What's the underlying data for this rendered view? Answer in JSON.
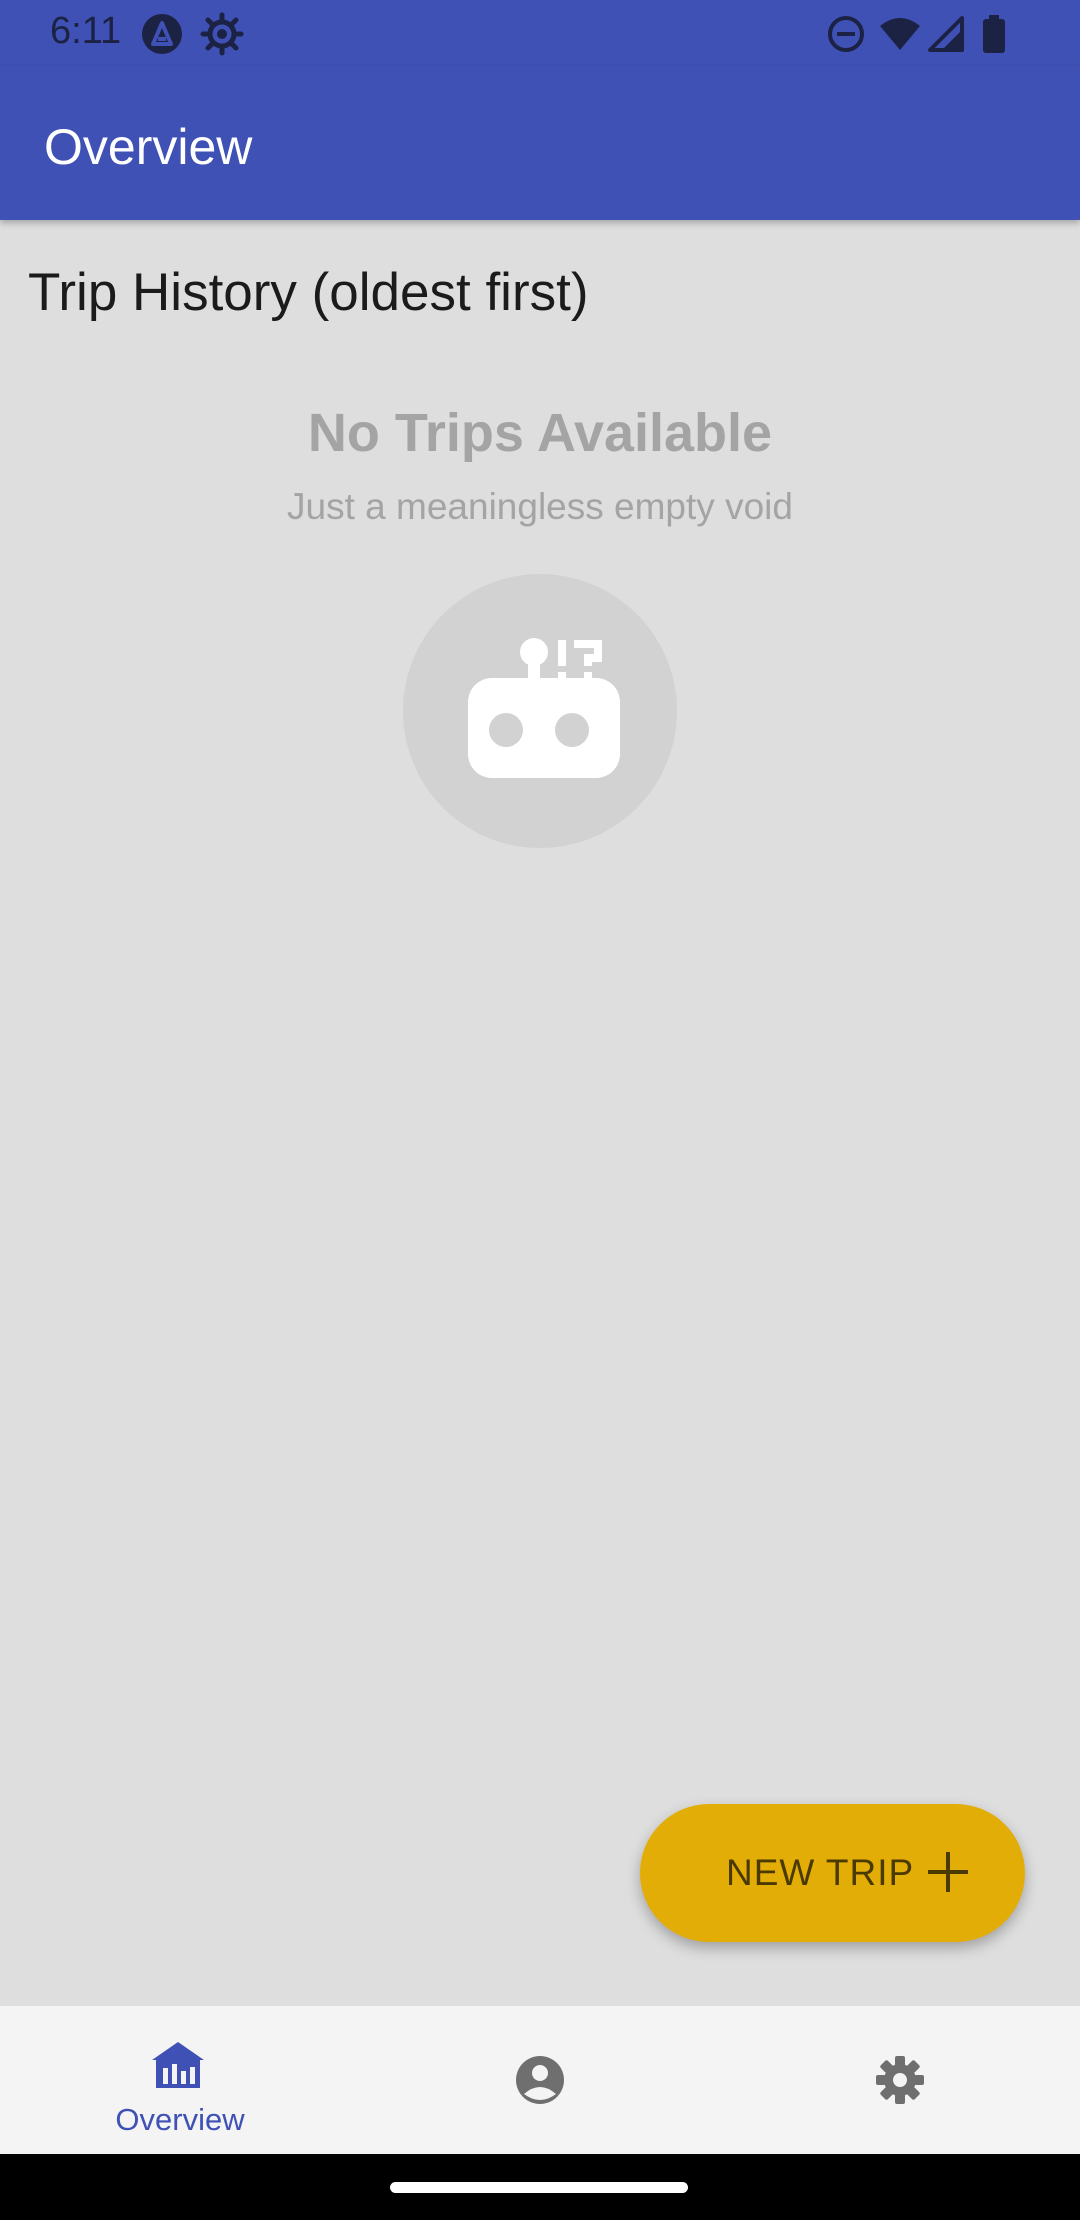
{
  "status_bar": {
    "time": "6:11",
    "left_icons": [
      "app-a-icon",
      "gear-icon"
    ],
    "right_icons": [
      "do-not-disturb-icon",
      "wifi-icon",
      "signal-icon",
      "battery-icon"
    ]
  },
  "app_bar": {
    "title": "Overview"
  },
  "content": {
    "section_title": "Trip History (oldest first)",
    "empty_state": {
      "title": "No Trips Available",
      "subtitle": "Just a meaningless empty void",
      "icon": "robot-confused-icon"
    }
  },
  "fab": {
    "label": "NEW TRIP",
    "icon": "plus-icon"
  },
  "bottom_nav": {
    "items": [
      {
        "label": "Overview",
        "icon": "home-chart-icon",
        "selected": true
      },
      {
        "label": "",
        "icon": "account-circle-icon",
        "selected": false
      },
      {
        "label": "",
        "icon": "settings-icon",
        "selected": false
      }
    ]
  },
  "colors": {
    "primary": "#3f51b5",
    "accent": "#e3ad07",
    "background": "#dedede",
    "empty_text": "#a4a4a4",
    "nav_background": "#f4f4f4",
    "nav_inactive": "#6f6f6f"
  }
}
